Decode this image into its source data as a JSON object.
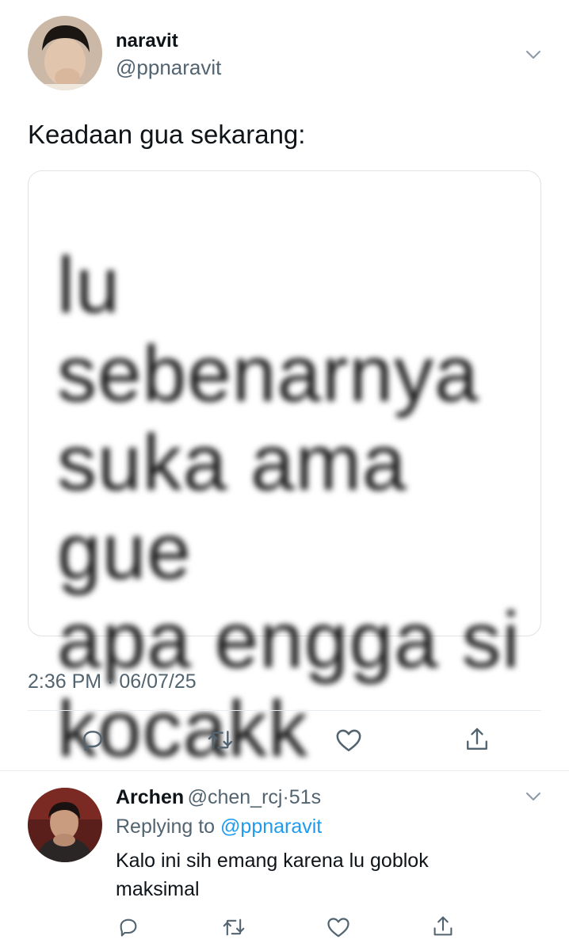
{
  "tweet": {
    "author_name": "naravit",
    "author_handle": "@ppnaravit",
    "text": "Keadaan gua sekarang:",
    "media_text": "lu sebenarnya\nsuka ama gue\napa engga si\nkocakk",
    "timestamp": "2:36 PM · 06/07/25",
    "actions": [
      "reply-icon",
      "retweet-icon",
      "like-icon",
      "share-icon"
    ]
  },
  "reply": {
    "author_name": "Archen",
    "author_handle": "@chen_rcj",
    "separator": "·",
    "time": "51s",
    "replying_label": "Replying to",
    "replying_handle": "@ppnaravit",
    "text": "Kalo ini sih emang karena lu goblok maksimal",
    "actions": [
      "reply-icon",
      "retweet-icon",
      "like-icon",
      "share-icon"
    ]
  },
  "colors": {
    "link": "#1d9bf0",
    "muted": "#536471",
    "text": "#0f1419"
  }
}
